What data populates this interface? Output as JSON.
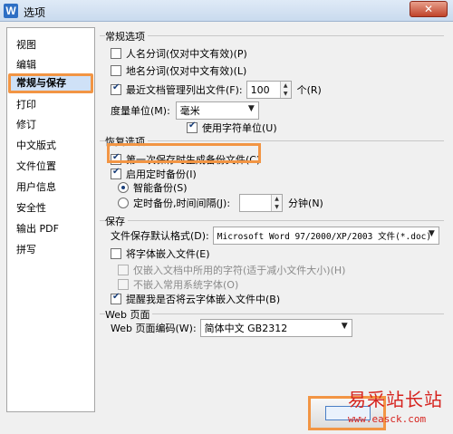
{
  "window": {
    "title": "选项",
    "app_icon": "W",
    "close_glyph": "✕"
  },
  "sidebar": {
    "items": [
      {
        "label": "视图",
        "selected": false
      },
      {
        "label": "编辑",
        "selected": false
      },
      {
        "label": "常规与保存",
        "selected": true
      },
      {
        "label": "打印",
        "selected": false
      },
      {
        "label": "修订",
        "selected": false
      },
      {
        "label": "中文版式",
        "selected": false
      },
      {
        "label": "文件位置",
        "selected": false
      },
      {
        "label": "用户信息",
        "selected": false
      },
      {
        "label": "安全性",
        "selected": false
      },
      {
        "label": "输出 PDF",
        "selected": false
      },
      {
        "label": "拼写",
        "selected": false
      }
    ]
  },
  "general": {
    "title": "常规选项",
    "person_name": "人名分词(仅对中文有效)(P)",
    "place_name": "地名分词(仅对中文有效)(L)",
    "recent_docs": "最近文档管理列出文件(F):",
    "recent_count": "100",
    "recent_unit": "个(R)",
    "measure_unit_label": "度量单位(M):",
    "measure_unit_value": "毫米",
    "char_unit": "使用字符单位(U)"
  },
  "recovery": {
    "title": "恢复选项",
    "first_backup": "第一次保存时生成备份文件(C)",
    "timed_backup": "启用定时备份(I)",
    "smart_backup": "智能备份(S)",
    "timed_interval": "定时备份,时间间隔(J):",
    "interval_unit": "分钟(N)"
  },
  "save": {
    "title": "保存",
    "default_format_label": "文件保存默认格式(D):",
    "default_format_value": "Microsoft Word 97/2000/XP/2003 文件(*.doc)",
    "embed_fonts": "将字体嵌入文件(E)",
    "embed_used_chars": "仅嵌入文档中所用的字符(适于减小文件大小)(H)",
    "no_common_fonts": "不嵌入常用系统字体(O)",
    "remind_cloud": "提醒我是否将云字体嵌入文件中(B)"
  },
  "web": {
    "title": "Web 页面",
    "encoding_label": "Web 页面编码(W):",
    "encoding_value": "简体中文 GB2312"
  },
  "watermark": {
    "title": "易采站长站",
    "url": "www.easck.com"
  }
}
